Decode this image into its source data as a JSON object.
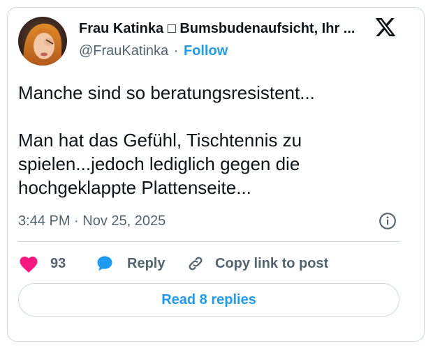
{
  "tweet": {
    "author_name": "Frau Katinka □ Bumsbudenaufsicht, Ihr ...",
    "handle": "@FrauKatinka",
    "separator": "·",
    "follow_label": "Follow",
    "text": "Manche sind so beratungsresistent...\n\nMan hat das Gefühl, Tischtennis zu spielen...jedoch lediglich gegen die hochgeklappte Plattenseite...",
    "timestamp": "3:44 PM · Nov 25, 2025"
  },
  "actions": {
    "like_count": "93",
    "reply_label": "Reply",
    "copy_label": "Copy link to post"
  },
  "footer": {
    "replies_label": "Read 8 replies"
  },
  "icons": {
    "logo": "x-logo-icon",
    "info": "info-icon",
    "like": "heart-icon",
    "reply": "speech-bubble-icon",
    "copy": "link-icon"
  },
  "colors": {
    "accent": "#1d9bf0",
    "heart": "#f91880",
    "secondary_text": "#536471",
    "border": "#cfd9de"
  }
}
